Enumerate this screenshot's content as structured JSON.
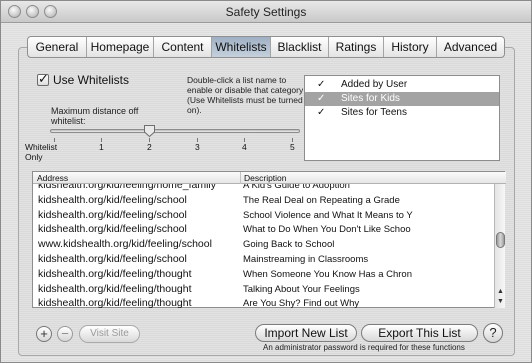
{
  "window": {
    "title": "Safety Settings"
  },
  "tabs": [
    {
      "label": "General"
    },
    {
      "label": "Homepage"
    },
    {
      "label": "Content"
    },
    {
      "label": "Whitelists",
      "active": true
    },
    {
      "label": "Blacklist"
    },
    {
      "label": "Ratings"
    },
    {
      "label": "History"
    },
    {
      "label": "Advanced"
    }
  ],
  "whitelist": {
    "use_label": "Use Whitelists",
    "use_checked": true,
    "hint": "Double-click a list name to enable or disable that category (Use Whitelists must be turned on).",
    "max_distance_label": "Maximum distance off whitelist:",
    "slider": {
      "min_label": "Whitelist Only",
      "ticks": [
        "1",
        "2",
        "3",
        "4",
        "5"
      ],
      "value": 2
    }
  },
  "categories": [
    {
      "label": "Added by User",
      "checked": true,
      "selected": false
    },
    {
      "label": "Sites for Kids",
      "checked": true,
      "selected": true
    },
    {
      "label": "Sites for Teens",
      "checked": true,
      "selected": false
    }
  ],
  "table": {
    "columns": {
      "address": "Address",
      "description": "Description"
    },
    "rows": [
      {
        "address": "kidshealth.org/kid/feeling/home_family",
        "description": "A Kid's Guide to Adoption"
      },
      {
        "address": "kidshealth.org/kid/feeling/school",
        "description": "The Real Deal on Repeating a Grade"
      },
      {
        "address": "kidshealth.org/kid/feeling/school",
        "description": "School Violence and What It Means to Y"
      },
      {
        "address": "kidshealth.org/kid/feeling/school",
        "description": "What to Do When You Don't Like Schoo"
      },
      {
        "address": "www.kidshealth.org/kid/feeling/school",
        "description": "Going Back to School"
      },
      {
        "address": "kidshealth.org/kid/feeling/school",
        "description": "Mainstreaming in Classrooms"
      },
      {
        "address": "kidshealth.org/kid/feeling/thought",
        "description": "When Someone You Know Has a Chron"
      },
      {
        "address": "kidshealth.org/kid/feeling/thought",
        "description": "Talking About Your Feelings"
      },
      {
        "address": "kidshealth.org/kid/feeling/thought",
        "description": "Are You Shy? Find out Why"
      }
    ]
  },
  "buttons": {
    "add": "+",
    "remove": "−",
    "visit_site": "Visit Site",
    "import": "Import New List",
    "export": "Export This List",
    "help": "?"
  },
  "admin_note": "An administrator password is required for these functions"
}
